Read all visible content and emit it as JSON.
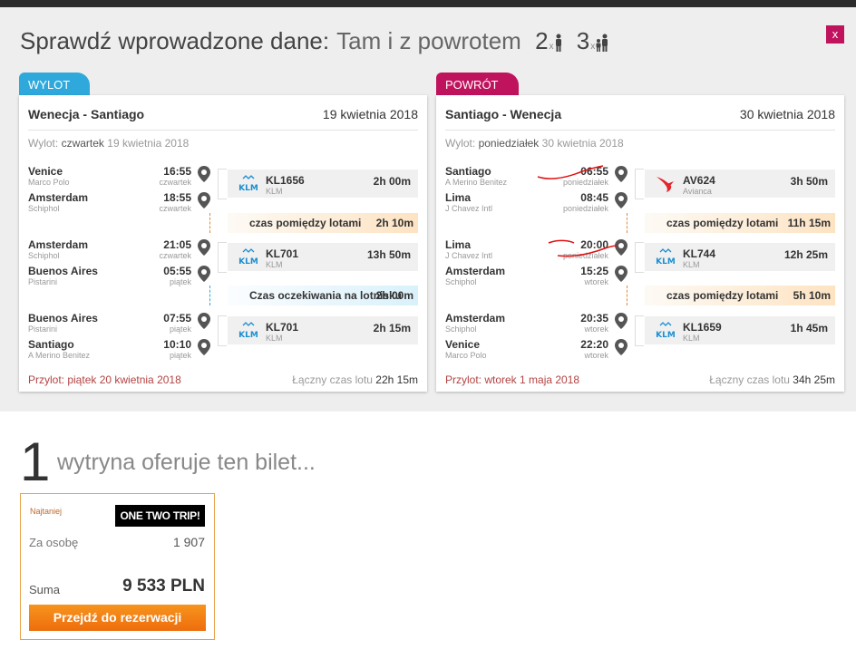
{
  "header": {
    "title": "Sprawdź wprowadzone dane:",
    "trip_type": "Tam i z powrotem",
    "adults": "2",
    "adults_sub": "x",
    "children": "3",
    "children_sub": "x",
    "close_label": "x"
  },
  "outbound": {
    "tag": "WYLOT",
    "route": "Wenecja - Santiago",
    "date": "19 kwietnia 2018",
    "departure_prefix": "Wylot:",
    "departure_day": "czwartek",
    "departure_date": "19 kwietnia 2018",
    "stops": [
      {
        "city": "Venice",
        "airport": "Marco Polo",
        "time": "16:55",
        "day": "czwartek"
      },
      {
        "city": "Amsterdam",
        "airport": "Schiphol",
        "time": "18:55",
        "day": "czwartek"
      },
      {
        "city": "Amsterdam",
        "airport": "Schiphol",
        "time": "21:05",
        "day": "czwartek"
      },
      {
        "city": "Buenos Aires",
        "airport": "Pistarini",
        "time": "05:55",
        "day": "piątek"
      },
      {
        "city": "Buenos Aires",
        "airport": "Pistarini",
        "time": "07:55",
        "day": "piątek"
      },
      {
        "city": "Santiago",
        "airport": "A Merino Benitez",
        "time": "10:10",
        "day": "piątek"
      }
    ],
    "flights": [
      {
        "number": "KL1656",
        "airline": "KLM",
        "duration": "2h 00m",
        "logo": "klm-logo"
      },
      {
        "number": "KL701",
        "airline": "KLM",
        "duration": "13h 50m",
        "logo": "klm-logo"
      },
      {
        "number": "KL701",
        "airline": "KLM",
        "duration": "2h 15m",
        "logo": "klm-logo"
      }
    ],
    "layovers": [
      {
        "label": "czas pomiędzy lotami",
        "value": "2h 10m"
      },
      {
        "label": "Czas oczekiwania na lotnisku",
        "value": "2h 00m"
      }
    ],
    "arrival": "Przylot: piątek 20 kwietnia 2018",
    "total_label": "Łączny czas lotu",
    "total_value": "22h 15m"
  },
  "return": {
    "tag": "POWRÓT",
    "route": "Santiago - Wenecja",
    "date": "30 kwietnia 2018",
    "departure_prefix": "Wylot:",
    "departure_day": "poniedziałek",
    "departure_date": "30 kwietnia 2018",
    "stops": [
      {
        "city": "Santiago",
        "airport": "A Merino Benitez",
        "time": "06:55",
        "day": "poniedziałek"
      },
      {
        "city": "Lima",
        "airport": "J Chavez Intl",
        "time": "08:45",
        "day": "poniedziałek"
      },
      {
        "city": "Lima",
        "airport": "J Chavez Intl",
        "time": "20:00",
        "day": "poniedziałek"
      },
      {
        "city": "Amsterdam",
        "airport": "Schiphol",
        "time": "15:25",
        "day": "wtorek"
      },
      {
        "city": "Amsterdam",
        "airport": "Schiphol",
        "time": "20:35",
        "day": "wtorek"
      },
      {
        "city": "Venice",
        "airport": "Marco Polo",
        "time": "22:20",
        "day": "wtorek"
      }
    ],
    "flights": [
      {
        "number": "AV624",
        "airline": "Avianca",
        "duration": "3h 50m",
        "logo": "avianca-logo"
      },
      {
        "number": "KL744",
        "airline": "KLM",
        "duration": "12h 25m",
        "logo": "klm-logo"
      },
      {
        "number": "KL1659",
        "airline": "KLM",
        "duration": "1h 45m",
        "logo": "klm-logo"
      }
    ],
    "layovers": [
      {
        "label": "czas pomiędzy lotami",
        "value": "11h 15m"
      },
      {
        "label": "czas pomiędzy lotami",
        "value": "5h 10m"
      }
    ],
    "arrival": "Przylot: wtorek 1 maja 2018",
    "total_label": "Łączny czas lotu",
    "total_value": "34h 25m"
  },
  "offers": {
    "count": "1",
    "text": "wytryna oferuje ten bilet...",
    "items": [
      {
        "badge": "Najtaniej",
        "partner": "ONE TWO TRIP!",
        "per_person_label": "Za osobę",
        "per_person_value": "1 907",
        "sum_label": "Suma",
        "sum_value": "9 533 PLN",
        "cta": "Przejdź do rezerwacji"
      }
    ]
  },
  "colors": {
    "accent_pink": "#c0135d",
    "accent_blue": "#2fa9dc",
    "cta_orange": "#f7941d",
    "arrival_red": "#b34343"
  }
}
